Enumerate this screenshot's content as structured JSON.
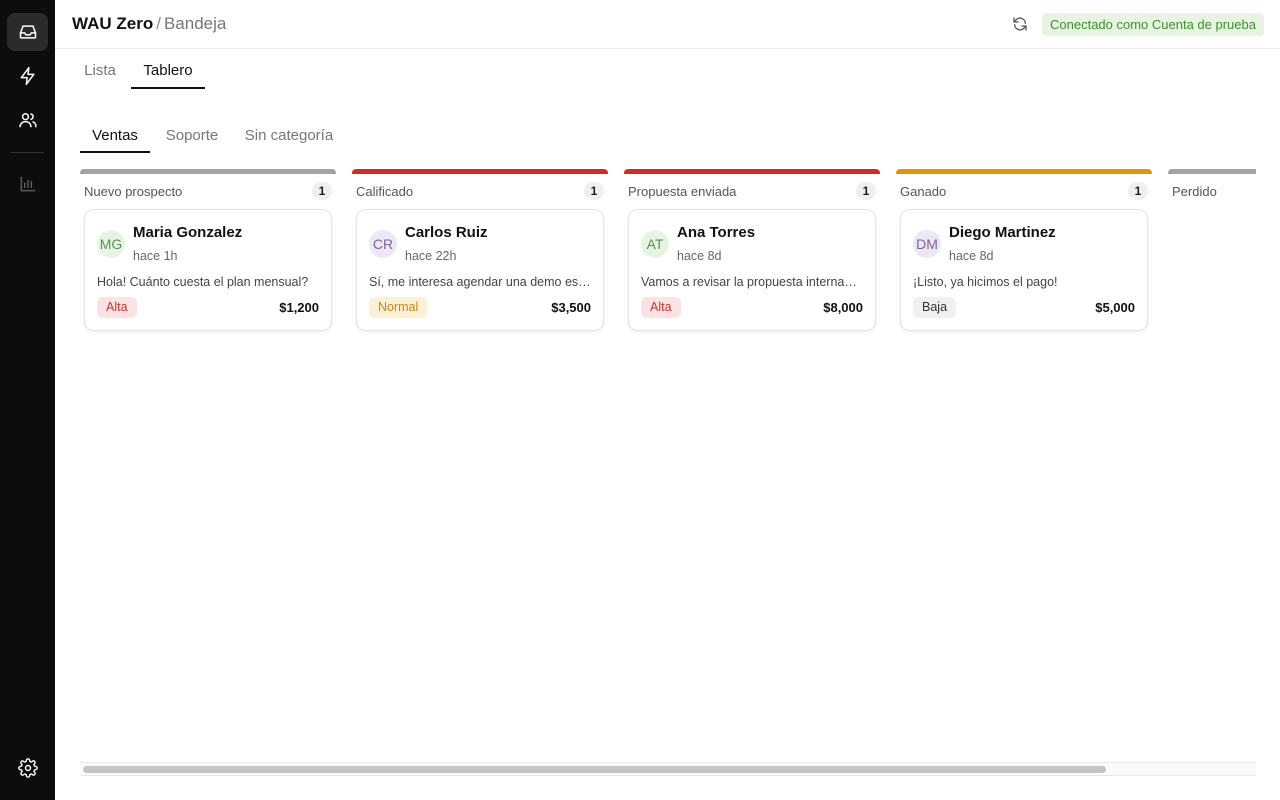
{
  "sidebar": {
    "items": [
      {
        "icon": "inbox-icon",
        "active": true
      },
      {
        "icon": "lightning-icon",
        "active": false
      },
      {
        "icon": "users-icon",
        "active": false
      },
      {
        "icon": "analytics-icon",
        "active": false,
        "disabled": true
      },
      {
        "icon": "gear-icon",
        "active": false
      }
    ]
  },
  "header": {
    "app_name": "WAU Zero",
    "separator": "/",
    "breadcrumb": "Bandeja",
    "refresh_icon": "refresh-icon",
    "status": "Conectado como Cuenta de prueba"
  },
  "view_tabs": [
    {
      "label": "Lista",
      "active": false
    },
    {
      "label": "Tablero",
      "active": true
    }
  ],
  "category_tabs": [
    {
      "label": "Ventas",
      "active": true
    },
    {
      "label": "Soporte",
      "active": false
    },
    {
      "label": "Sin categoría",
      "active": false
    }
  ],
  "columns": [
    {
      "title": "Nuevo prospecto",
      "count": "1",
      "color": "#a3a3a3",
      "card": {
        "initials": "MG",
        "name": "Maria Gonzalez",
        "time": "hace 1h",
        "message": "Hola! Cuánto cuesta el plan mensual?",
        "priority": "Alta",
        "amount": "$1,200",
        "avatar_bg": "#e7f4e4",
        "avatar_fg": "#5b8f55"
      }
    },
    {
      "title": "Calificado",
      "count": "1",
      "color": "#cf2d2d",
      "card": {
        "initials": "CR",
        "name": "Carlos Ruiz",
        "time": "hace 22h",
        "message": "Sí, me interesa agendar una demo esta semana",
        "priority": "Normal",
        "amount": "$3,500",
        "avatar_bg": "#ece6f6",
        "avatar_fg": "#7a6897"
      }
    },
    {
      "title": "Propuesta enviada",
      "count": "1",
      "color": "#cf2d2d",
      "card": {
        "initials": "AT",
        "name": "Ana Torres",
        "time": "hace 8d",
        "message": "Vamos a revisar la propuesta internamente",
        "priority": "Alta",
        "amount": "$8,000",
        "avatar_bg": "#e7f4e4",
        "avatar_fg": "#5b8f55"
      }
    },
    {
      "title": "Ganado",
      "count": "1",
      "color": "#e0960b",
      "card": {
        "initials": "DM",
        "name": "Diego Martinez",
        "time": "hace 8d",
        "message": "¡Listo, ya hicimos el pago!",
        "priority": "Baja",
        "amount": "$5,000",
        "avatar_bg": "#ece6f6",
        "avatar_fg": "#7a6897"
      }
    },
    {
      "title": "Perdido",
      "count": "",
      "color": "#a3a3a3",
      "card": null
    }
  ],
  "priority_styles": {
    "Alta": {
      "bg": "#fbe3e3",
      "fg": "#c43333"
    },
    "Normal": {
      "bg": "#fdf0d6",
      "fg": "#c8860c"
    },
    "Baja": {
      "bg": "#f0f0f0",
      "fg": "#333333"
    }
  }
}
